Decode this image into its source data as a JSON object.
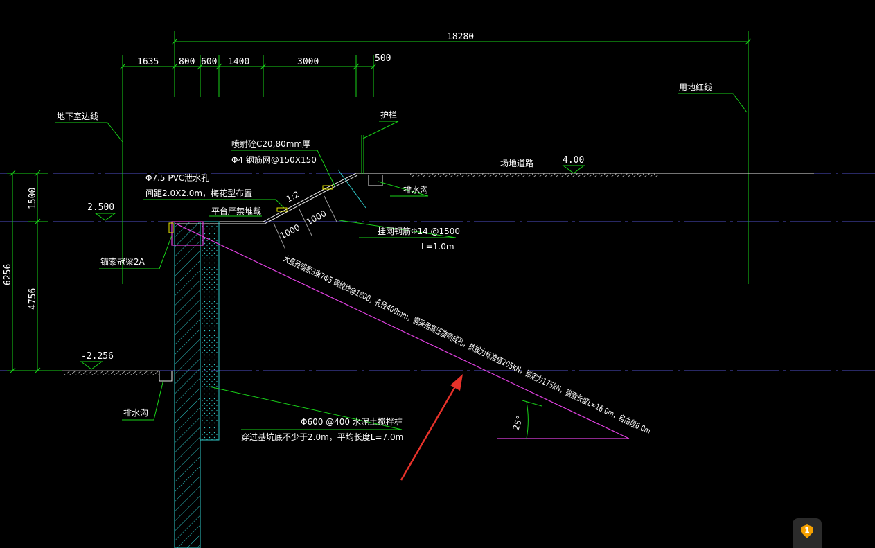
{
  "dimensions": {
    "total": "18280",
    "segments": [
      "1635",
      "800",
      "600",
      "1400",
      "3000",
      "500"
    ],
    "left_total": "6256",
    "left_upper": "1500",
    "left_lower": "4756"
  },
  "elevations": {
    "ground_top": "4.00",
    "platform": "2.500",
    "pit_bottom": "-2.256"
  },
  "labels": {
    "basement_line": "地下室边线",
    "guardrail": "护栏",
    "property_line": "用地红线",
    "site_road": "场地道路",
    "shotcrete": "喷射砼C20,80mm厚",
    "mesh": "Φ4 钢筋网@150X150",
    "pvc_hole_1": "Φ7.5 PVC泄水孔",
    "pvc_hole_2": "间距2.0X2.0m，梅花型布置",
    "platform_finish": "平台严禁堆载",
    "drain_top": "排水沟",
    "drain_bottom": "排水沟",
    "crown_beam": "锚索冠梁2A",
    "slope_ratio": "1:2",
    "slope_len_1": "1000",
    "slope_len_2": "1000",
    "nail_1": "挂网钢筋Φ14 @1500",
    "nail_2": "L=1.0m",
    "anchor_text": "大直径锚索3束7Φ5 钢绞线@1800，孔径400mm，需采用高压旋喷成孔，抗拔力标准值205kN，锁定力175kN，锚索长度L=16.0m，自由段6.0m",
    "angle": "25°",
    "pile_1": "Φ600 @400 水泥土搅拌桩",
    "pile_2": "穿过基坑底不少于2.0m，平均长度L=7.0m"
  },
  "badge": {
    "count": "1",
    "icon": "shield-icon"
  },
  "colors": {
    "background": "#000000",
    "dimension": "#19d219",
    "gridline": "#5050c8",
    "anchor": "#e040e0",
    "pile": "#2fc8c8",
    "arrow": "#e8322a",
    "badge": "#f5a000"
  }
}
